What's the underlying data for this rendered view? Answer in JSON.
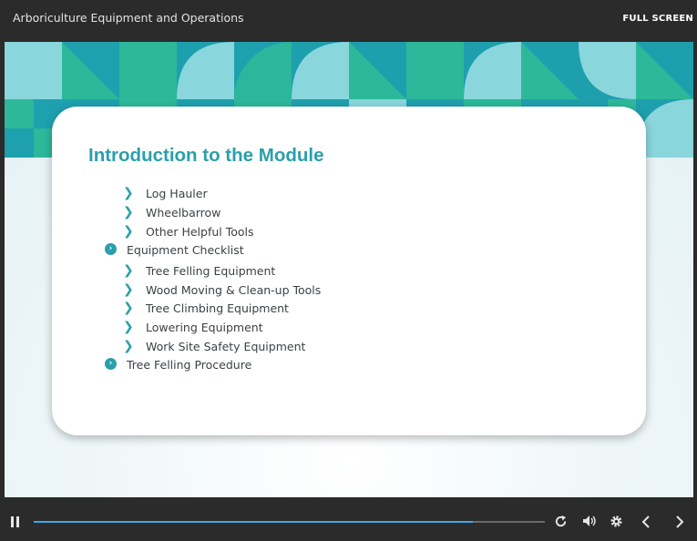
{
  "header": {
    "course_title": "Arboriculture Equipment and Operations",
    "fullscreen_label": "FULL SCREEN"
  },
  "slide": {
    "title": "Introduction to the Module",
    "items": [
      {
        "label": "Log Hauler",
        "level": 2
      },
      {
        "label": "Wheelbarrow",
        "level": 2
      },
      {
        "label": "Other Helpful Tools",
        "level": 2
      },
      {
        "label": "Equipment Checklist",
        "level": 1
      },
      {
        "label": "Tree Felling Equipment",
        "level": 2
      },
      {
        "label": "Wood Moving & Clean-up Tools",
        "level": 2
      },
      {
        "label": "Tree Climbing Equipment",
        "level": 2
      },
      {
        "label": "Lowering Equipment",
        "level": 2
      },
      {
        "label": "Work Site Safety Equipment",
        "level": 2
      },
      {
        "label": "Tree Felling Procedure",
        "level": 1
      }
    ]
  },
  "player": {
    "progress": 0.86,
    "accent": "#3ba9e0"
  },
  "colors": {
    "teal": "#2a9fac",
    "banner_dark": "#1fa0ae",
    "banner_green": "#2db89a",
    "banner_light": "#8ad6dd"
  }
}
